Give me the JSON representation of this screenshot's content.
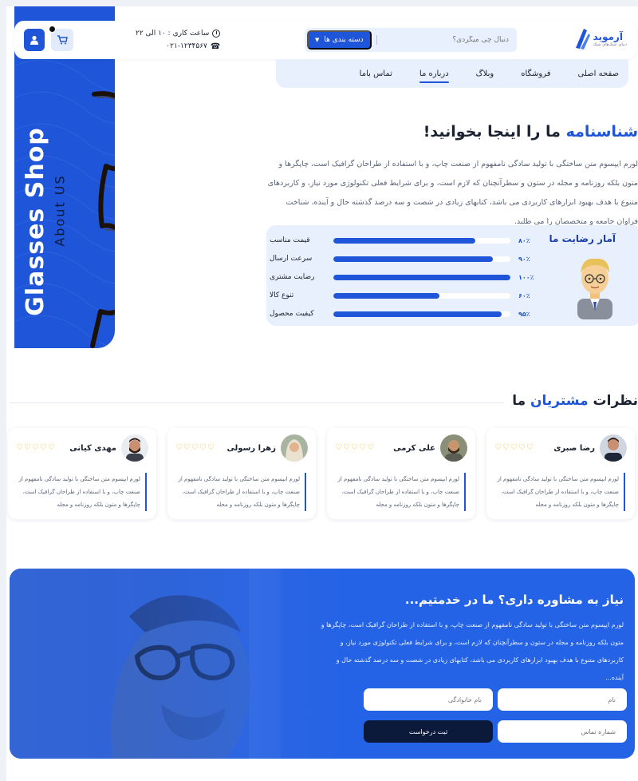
{
  "header": {
    "logo_name": "آرموید",
    "logo_sub": "دنیای عینک‌های شیک",
    "search_placeholder": "دنبال چی میگردی؟",
    "category_button": "دسته بندی ها",
    "hours": "ساعت کاری : ۱۰ الی ۲۲",
    "phone": "۰۲۱-۱۲۳۴۵۶۷"
  },
  "nav": {
    "items": [
      "صفحه اصلی",
      "فروشگاه",
      "وبلاگ",
      "درباره ما",
      "تماس باما"
    ],
    "active": "درباره ما"
  },
  "banner": {
    "title": "Glasses Shop",
    "subtitle": "About US"
  },
  "about": {
    "title_accent": "شناسنامه",
    "title_rest": " ما را اینجا بخوانید!",
    "text": "لورم ایپسوم متن ساختگی با تولید سادگی نامفهوم از صنعت چاپ، و با استفاده از طراحان گرافیک است، چاپگرها و متون بلکه روزنامه و مجله در ستون و سطرآنچنان که لازم است، و برای شرایط فعلی تکنولوژی مورد نیاز، و کاربردهای متنوع با هدف بهبود ابزارهای کاربردی می باشد، کتابهای زیادی در شصت و سه درصد گذشته حال و آینده، شناخت فراوان جامعه و متخصصان را می طلبد."
  },
  "stats": {
    "title": "آمار رضایت ما",
    "rows": [
      {
        "label": "قیمت مناسب",
        "pct_text": "۸۰٪",
        "value": 80
      },
      {
        "label": "سرعت ارسال",
        "pct_text": "۹۰٪",
        "value": 90
      },
      {
        "label": "رضایت مشتری",
        "pct_text": "۱۰۰٪",
        "value": 100
      },
      {
        "label": "تنوع کالا",
        "pct_text": "۶۰٪",
        "value": 60
      },
      {
        "label": "کیفیت محصول",
        "pct_text": "۹۵٪",
        "value": 95
      }
    ]
  },
  "reviews": {
    "title_rest": "نظرات ",
    "title_accent": "مشتریان",
    "title_end": " ما",
    "stars": "♡♡♡♡♡",
    "items": [
      {
        "name": "رضا صبری",
        "text": "لورم ایپسوم متن ساختگی با تولید سادگی نامفهوم از صنعت چاپ، و با استفاده از طراحان گرافیک است، چاپگرها و متون بلکه روزنامه و مجله"
      },
      {
        "name": "علی کرمی",
        "text": "لورم ایپسوم متن ساختگی با تولید سادگی نامفهوم از صنعت چاپ، و با استفاده از طراحان گرافیک است، چاپگرها و متون بلکه روزنامه و مجله"
      },
      {
        "name": "زهرا رسولی",
        "text": "لورم ایپسوم متن ساختگی با تولید سادگی نامفهوم از صنعت چاپ، و با استفاده از طراحان گرافیک است، چاپگرها و متون بلکه روزنامه و مجله"
      },
      {
        "name": "مهدی کیانی",
        "text": "لورم ایپسوم متن ساختگی با تولید سادگی نامفهوم از صنعت چاپ، و با استفاده از طراحان گرافیک است، چاپگرها و متون بلکه روزنامه و مجله"
      }
    ]
  },
  "consult": {
    "title": "نیاز به مشاوره داری؟ ما در خدمتیم...",
    "text": "لورم ایپسوم متن ساختگی با تولید سادگی نامفهوم از صنعت چاپ، و با استفاده از طراحان گرافیک است، چاپگرها و متون بلکه روزنامه و مجله در ستون و سطرآنچنان که لازم است، و برای شرایط فعلی تکنولوژی مورد نیاز، و کاربردهای متنوع با هدف بهبود ابزارهای کاربردی می باشد، کتابهای زیادی در شصت و سه درصد گذشته حال و آینده...",
    "first_name_placeholder": "نام",
    "last_name_placeholder": "نام خانوادگی",
    "phone_placeholder": "شماره تماس",
    "submit": "ثبت درخواست"
  },
  "colors": {
    "accent": "#1f55d8",
    "dark": "#0b1a3a",
    "stars": "#f4b400"
  }
}
